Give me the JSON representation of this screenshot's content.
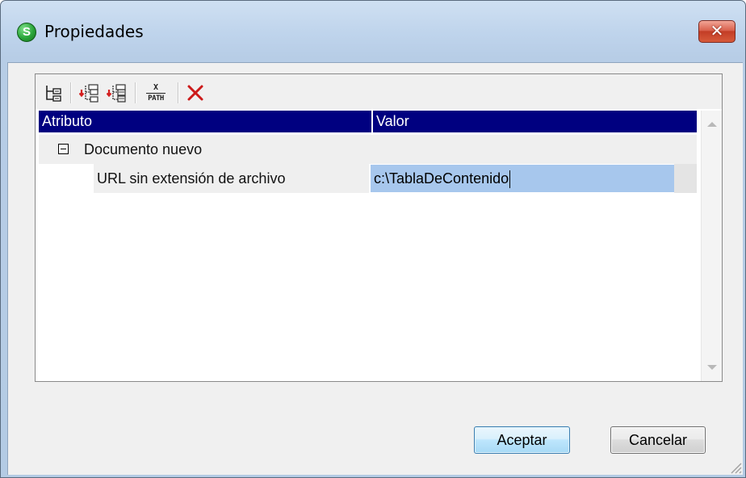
{
  "window": {
    "title": "Propiedades",
    "close_symbol": "✕",
    "app_icon_letter": "S"
  },
  "toolbar": {
    "icons": [
      "tree-view-icon",
      "add-child-element-icon",
      "add-sibling-element-icon",
      "xpath-icon",
      "delete-icon"
    ],
    "xpath_label_top": "X",
    "xpath_label_bottom": "PATH"
  },
  "grid": {
    "columns": [
      "Atributo",
      "Valor"
    ],
    "rows": [
      {
        "label": "Documento nuevo",
        "value": "",
        "expanded": true,
        "level": 0
      },
      {
        "label": "URL sin extensión de archivo",
        "value": "c:\\TablaDeContenido",
        "level": 1,
        "editing": true
      }
    ]
  },
  "buttons": {
    "ok": "Aceptar",
    "cancel": "Cancelar"
  },
  "colors": {
    "header_bg": "#000080",
    "selected_value_bg": "#a7c7ed",
    "close_button": "#c9452c"
  }
}
